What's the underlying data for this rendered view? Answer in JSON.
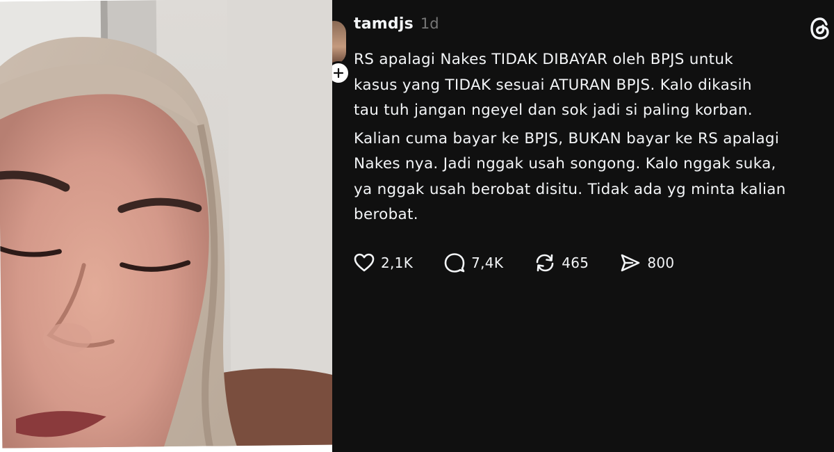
{
  "post": {
    "username": "tamdjs",
    "timestamp": "1d",
    "lines_para1": [
      "RS apalagi Nakes TIDAK DIBAYAR oleh BPJS untuk",
      "kasus yang TIDAK sesuai ATURAN BPJS. Kalo dikasih",
      "tau tuh jangan ngeyel dan sok jadi si paling korban."
    ],
    "lines_para2": [
      "Kalian cuma bayar ke BPJS, BUKAN bayar ke RS apalagi",
      "Nakes nya. Jadi nggak usah songong. Kalo nggak suka,",
      "ya nggak usah berobat disitu. Tidak ada yg minta kalian",
      "berobat."
    ],
    "actions": {
      "likes": "2,1K",
      "replies": "7,4K",
      "reposts": "465",
      "shares": "800"
    }
  },
  "icons": {
    "like": "heart-icon",
    "reply": "speech-bubble-icon",
    "repost": "repost-icon",
    "share": "send-icon",
    "brand": "threads-logo-icon",
    "follow": "plus-icon"
  },
  "colors": {
    "post_background": "#101010",
    "text_primary": "#f3f5f7",
    "text_secondary": "#777777"
  }
}
